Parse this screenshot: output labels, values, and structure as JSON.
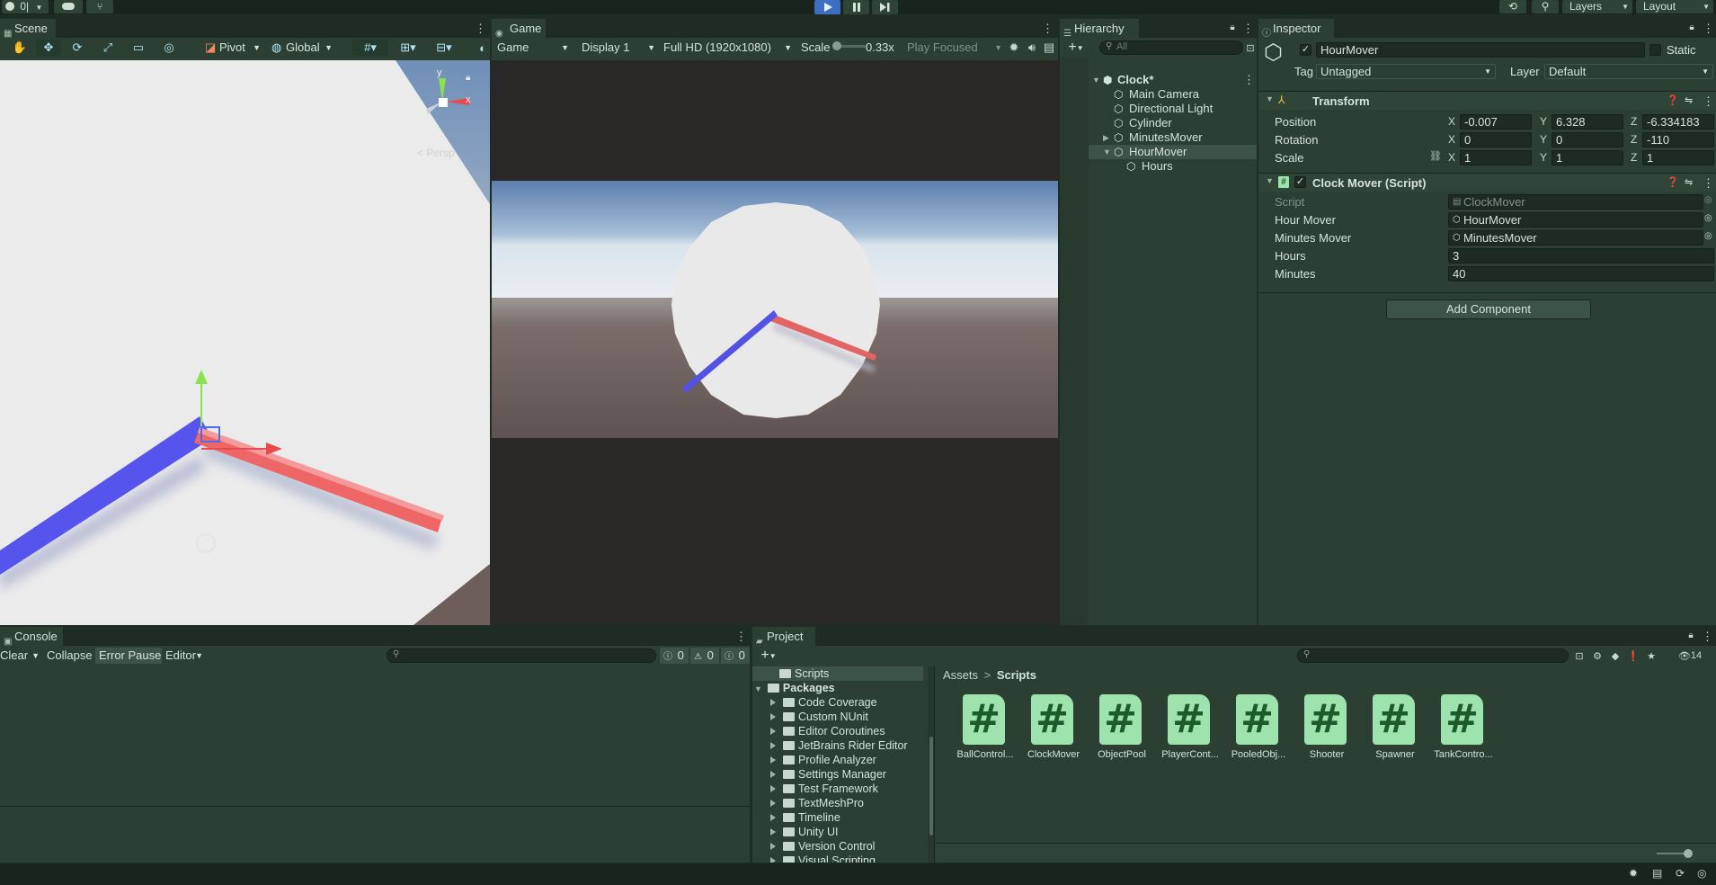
{
  "toolbar": {
    "account_label": "0|",
    "layers_label": "Layers",
    "layout_label": "Layout"
  },
  "scene": {
    "tab_label": "Scene",
    "pivot_label": "Pivot",
    "global_label": "Global",
    "persp_label": "< Persp",
    "gizmo_y": "y",
    "gizmo_x": "x"
  },
  "game": {
    "tab_label": "Game",
    "mode": "Game",
    "display": "Display 1",
    "resolution": "Full HD (1920x1080)",
    "scale_label": "Scale",
    "scale_value": "0.33x",
    "play_focused": "Play Focused"
  },
  "hierarchy": {
    "tab_label": "Hierarchy",
    "search_placeholder": "All",
    "scene_name": "Clock*",
    "items": [
      {
        "label": "Main Camera"
      },
      {
        "label": "Directional Light"
      },
      {
        "label": "Cylinder"
      },
      {
        "label": "MinutesMover"
      },
      {
        "label": "HourMover"
      },
      {
        "label": "Hours"
      }
    ]
  },
  "inspector": {
    "tab_label": "Inspector",
    "object_name": "HourMover",
    "static_label": "Static",
    "tag_label": "Tag",
    "tag_value": "Untagged",
    "layer_label": "Layer",
    "layer_value": "Default",
    "transform": {
      "title": "Transform",
      "position_label": "Position",
      "rotation_label": "Rotation",
      "scale_label": "Scale",
      "axis_x": "X",
      "axis_y": "Y",
      "axis_z": "Z",
      "position": {
        "x": "-0.007",
        "y": "6.328",
        "z": "-6.334183"
      },
      "rotation": {
        "x": "0",
        "y": "0",
        "z": "-110"
      },
      "scale": {
        "x": "1",
        "y": "1",
        "z": "1"
      }
    },
    "clock_mover": {
      "title": "Clock Mover (Script)",
      "script_label": "Script",
      "script_value": "ClockMover",
      "hour_mover_label": "Hour Mover",
      "hour_mover_value": "HourMover",
      "minutes_mover_label": "Minutes Mover",
      "minutes_mover_value": "MinutesMover",
      "hours_label": "Hours",
      "hours_value": "3",
      "minutes_label": "Minutes",
      "minutes_value": "40"
    },
    "add_component_label": "Add Component"
  },
  "console": {
    "tab_label": "Console",
    "clear_label": "Clear",
    "collapse_label": "Collapse",
    "error_pause_label": "Error Pause",
    "editor_label": "Editor",
    "count_log": "0",
    "count_warn": "0",
    "count_error": "0"
  },
  "project": {
    "tab_label": "Project",
    "visible_count": "14",
    "breadcrumb_root": "Assets",
    "breadcrumb_sep": ">",
    "breadcrumb_current": "Scripts",
    "tree": {
      "scripts_folder": "Scripts",
      "packages": "Packages",
      "package_items": [
        "Code Coverage",
        "Custom NUnit",
        "Editor Coroutines",
        "JetBrains Rider Editor",
        "Profile Analyzer",
        "Settings Manager",
        "Test Framework",
        "TextMeshPro",
        "Timeline",
        "Unity UI",
        "Version Control",
        "Visual Scripting"
      ]
    },
    "assets": [
      {
        "label": "BallControl..."
      },
      {
        "label": "ClockMover"
      },
      {
        "label": "ObjectPool"
      },
      {
        "label": "PlayerCont..."
      },
      {
        "label": "PooledObj..."
      },
      {
        "label": "Shooter"
      },
      {
        "label": "Spawner"
      },
      {
        "label": "TankContro..."
      }
    ],
    "asset_glyph": "#"
  },
  "colors": {
    "accent_blue": "#3d6ec2",
    "hour_hand": "#5a5aee",
    "minute_hand": "#ee6464",
    "script_icon": "#9ee3ad"
  }
}
